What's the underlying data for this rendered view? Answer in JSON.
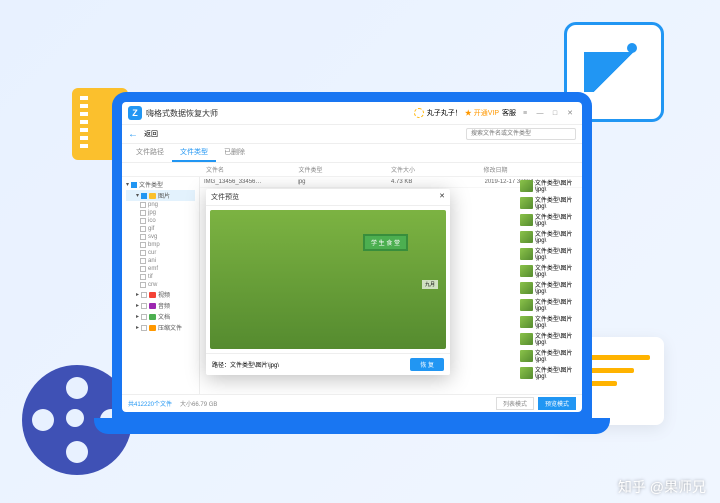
{
  "app_title": "嗨格式数据恢复大师",
  "watermark": "知乎 @果师兄",
  "titlebar": {
    "username": "丸子丸子！",
    "vip_text": "★ 开通VIP",
    "support": "客服",
    "menu": "客服"
  },
  "nav": {
    "back_label": "返回",
    "search_placeholder": "搜索文件名或文件类型"
  },
  "top_tabs": {
    "path": "文件路径",
    "type": "文件类型",
    "deleted": "已删除"
  },
  "headers": {
    "name": "文件名",
    "type": "文件类型",
    "size": "文件大小",
    "date": "修改日期"
  },
  "tree": {
    "root": "文件类型",
    "image": "图片",
    "items": [
      "png",
      "jpg",
      "ico",
      "gif",
      "svg",
      "bmp",
      "cur",
      "ani",
      "emf",
      "tif",
      "crw"
    ],
    "video": "视频",
    "audio": "音频",
    "document": "文档",
    "archive": "压缩文件"
  },
  "file_row": {
    "name": "IMG_13456_33456…",
    "ext": "jpg",
    "size": "4.73 KB",
    "date": "2019-12-17 3:23:4…"
  },
  "thumbs": {
    "label": "文件类型\\图片\\jpg\\"
  },
  "preview": {
    "title": "文件预览",
    "sign": "学 生 食 堂",
    "badge": "九月",
    "path_label": "路径：文件类型\\图片\\jpg\\",
    "recover": "恢 复"
  },
  "statusbar": {
    "count": "共412220个文件",
    "size": "大小66.79 GB",
    "mode_list": "列表模式",
    "mode_preview": "预览模式"
  }
}
